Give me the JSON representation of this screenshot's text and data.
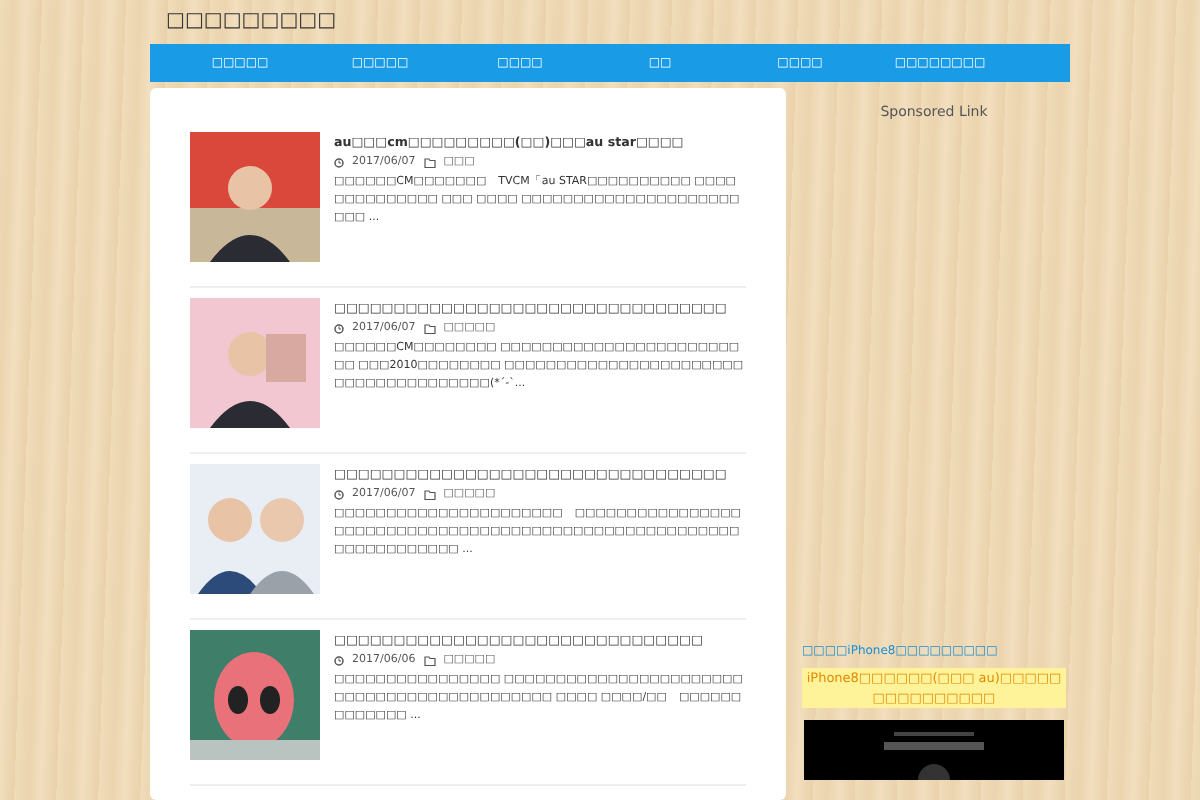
{
  "site_title": "□□□□□□□□□",
  "nav": [
    {
      "label": "□□□□□"
    },
    {
      "label": "□□□□□"
    },
    {
      "label": "□□□□"
    },
    {
      "label": "□□"
    },
    {
      "label": "□□□□"
    },
    {
      "label": "□□□□□□□□"
    }
  ],
  "posts": [
    {
      "title": "au□□□cm□□□□□□□□□(□□)□□□au star□□□□",
      "date": "2017/06/07",
      "category": "□□□",
      "excerpt": "□□□□□□CM□□□□□□□　TVCM「au STAR□□□□□□□□□□ □□□□□□□□□□□□□□ □□□ □□□□ □□□□□□□□□□□□□□□□□□□□□□□□ ..."
    },
    {
      "title": "□□□□□□□□□□□□□□□□□□□□□□□□□□□□□□□□□",
      "date": "2017/06/07",
      "category": "□□□□□",
      "excerpt": "□□□□□□CM□□□□□□□□ □□□□□□□□□□□□□□□□□□□□□□□□□ □□□2010□□□□□□□□ □□□□□□□□□□□□□□□□□□□□□□□□□□□□□□□□□□□□□□(*´-`..."
    },
    {
      "title": "□□□□□□□□□□□□□□□□□□□□□□□□□□□□□□□□□",
      "date": "2017/06/07",
      "category": "□□□□□",
      "excerpt": "□□□□□□□□□□□□□□□□□□□□□□　□□□□□□□□□□□□□□□□□□□□□□□□□□□□□□□□□□□□□□□□□□□□□□□□□□□□□□□□□□□□□□□□□□□ ..."
    },
    {
      "title": "□□□□□□□□□□□□□□□□□□□□□□□□□□□□□□□",
      "date": "2017/06/06",
      "category": "□□□□□",
      "excerpt": "□□□□□□□□□□□□□□□□ □□□□□□□□□□□□□□□□□□□□□□□□□□□□□□□□□□□□□□□□□□□□ □□□□ □□□□/□□　□□□□□□□□□□□□□ ..."
    }
  ],
  "sidebar": {
    "heading": "Sponsored Link",
    "link": "□□□□iPhone8□□□□□□□□□",
    "highlight": "iPhone8□□□□□□(□□□ au)□□□□□□□□□□□□□□□"
  }
}
